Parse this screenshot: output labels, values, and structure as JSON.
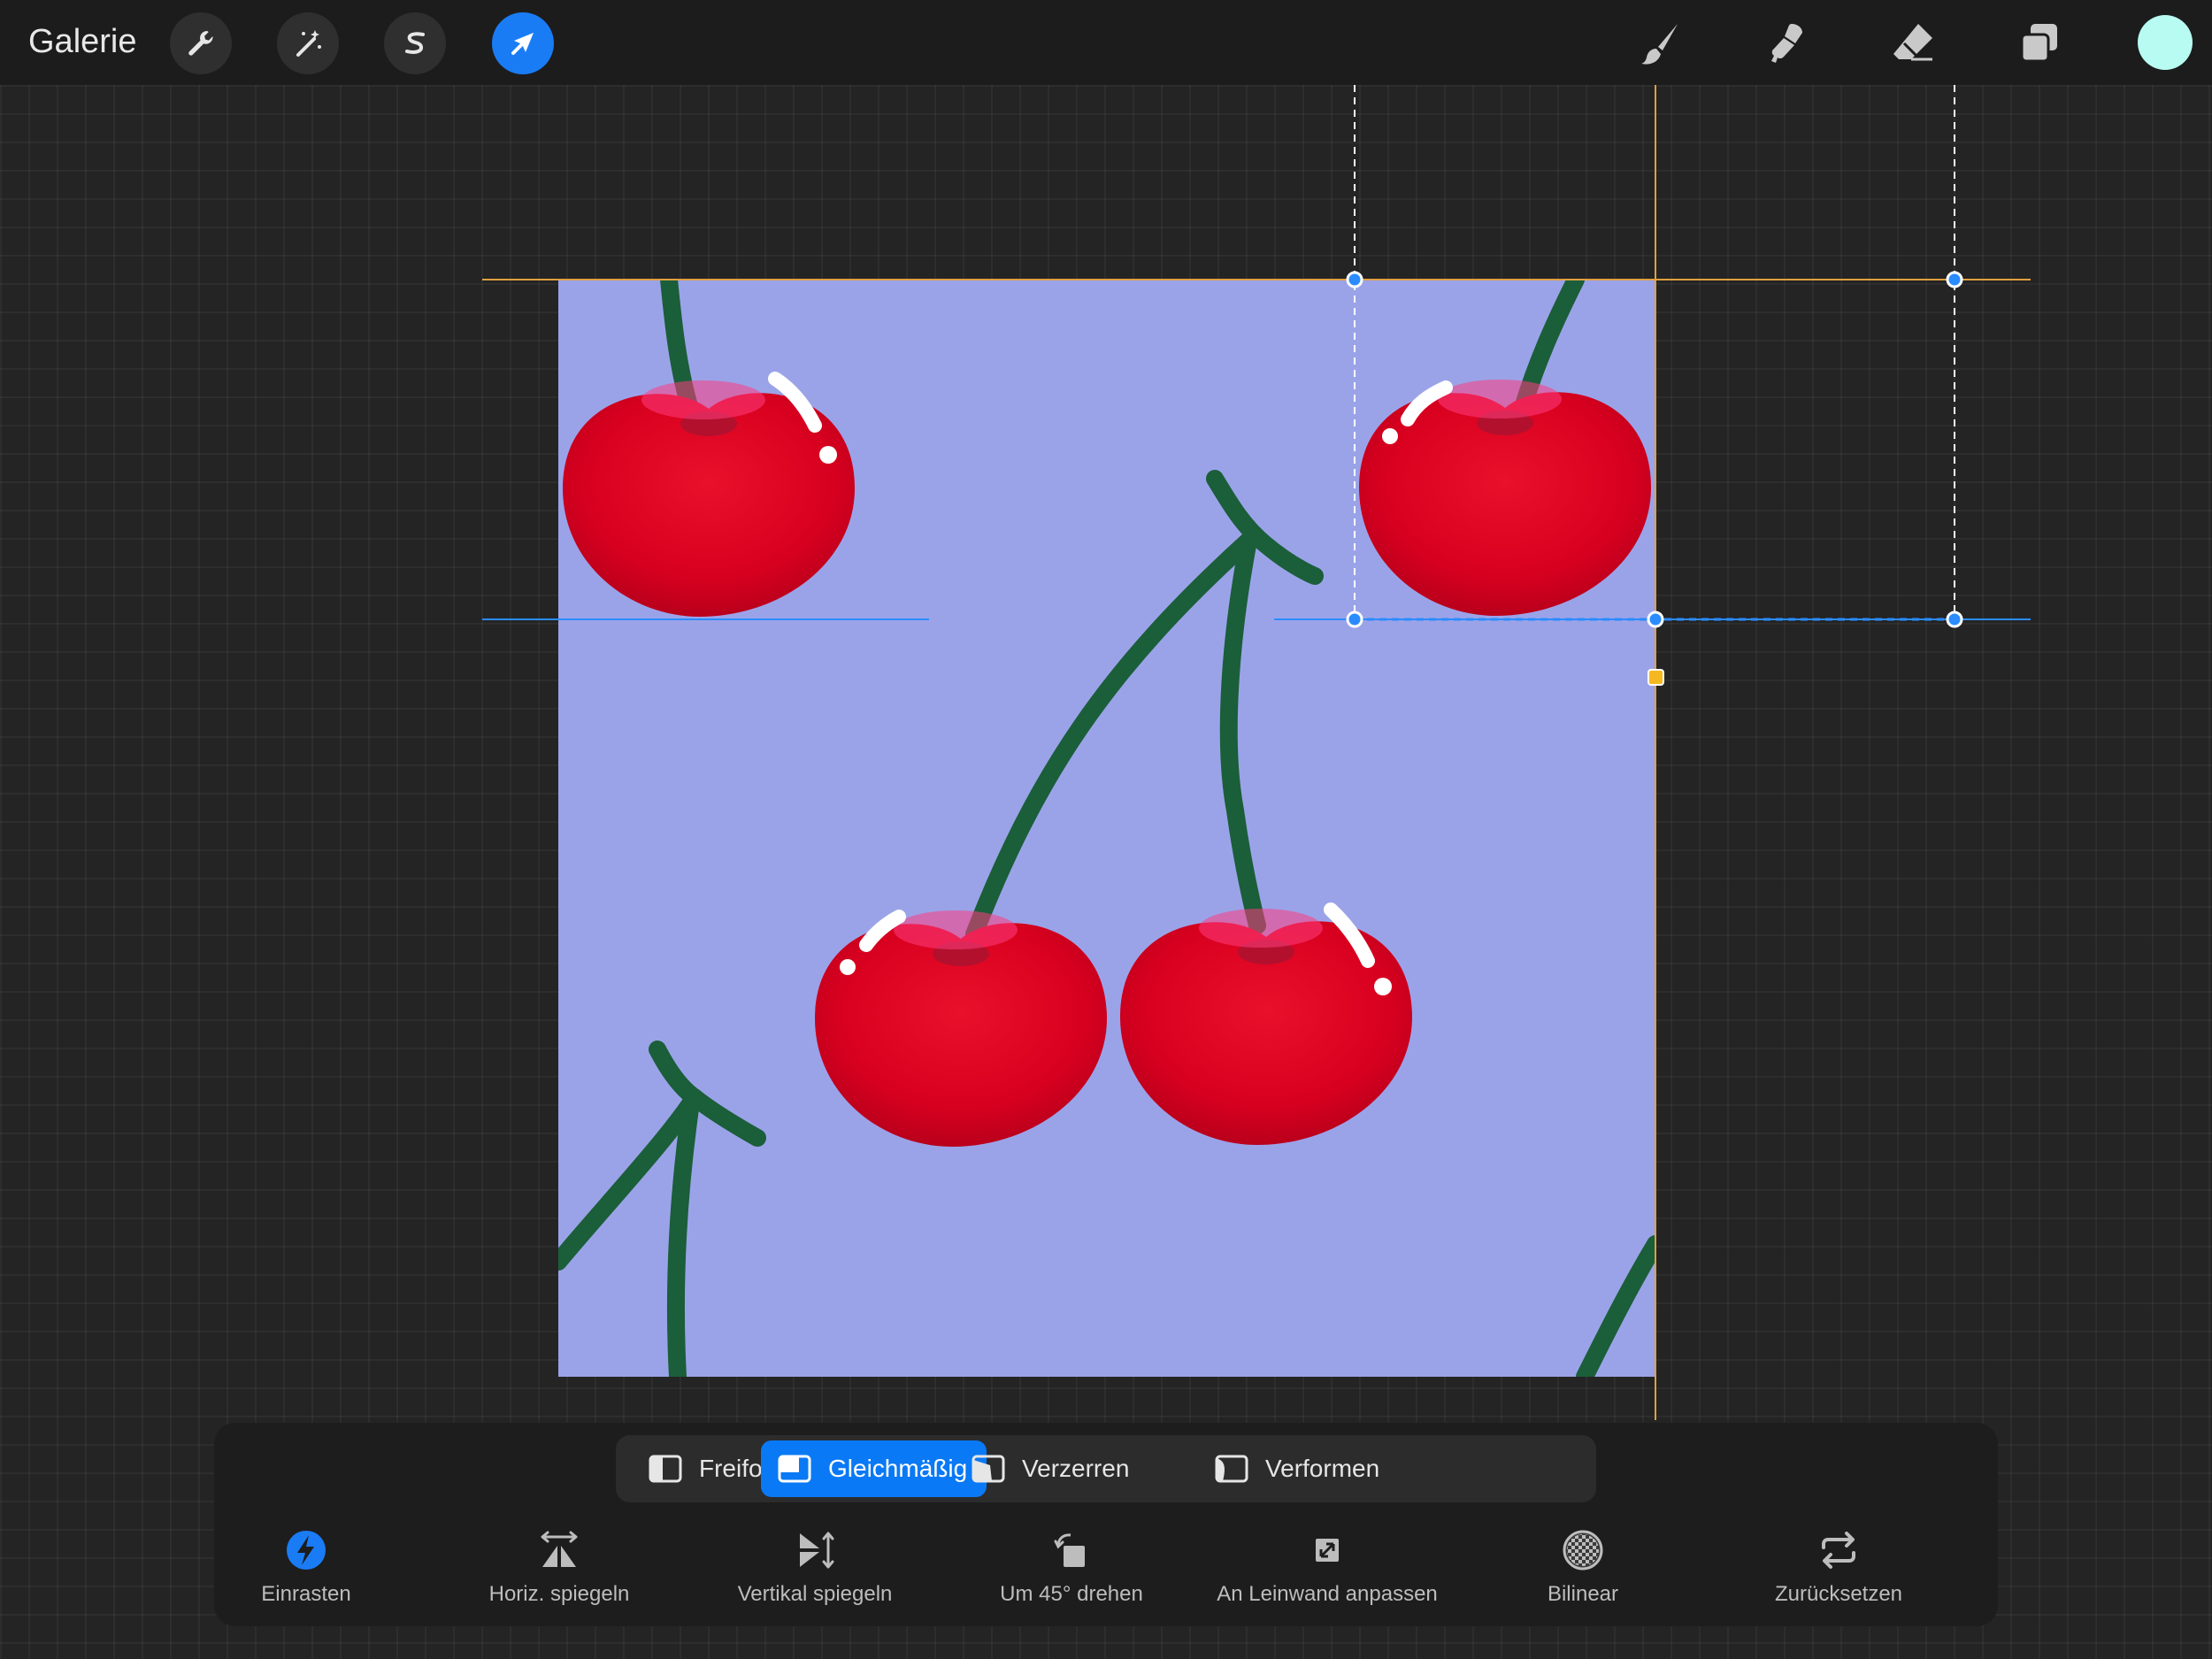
{
  "topbar": {
    "gallery_label": "Galerie",
    "tools_left": [
      "wrench-icon",
      "magic-wand-icon",
      "selection-s-icon",
      "transform-arrow-icon"
    ],
    "tools_right": [
      "brush-icon",
      "smudge-icon",
      "eraser-icon",
      "layers-icon"
    ],
    "active_tool": "transform-arrow-icon",
    "current_color": "#b8fbf2"
  },
  "canvas": {
    "background_color": "#9ba3e8",
    "content": "cherry-pattern-artwork"
  },
  "transform_modes": [
    {
      "label": "Freiform",
      "icon": "freeform-mode-icon",
      "active": false
    },
    {
      "label": "Gleichmäßig",
      "icon": "uniform-mode-icon",
      "active": true
    },
    {
      "label": "Verzerren",
      "icon": "distort-mode-icon",
      "active": false
    },
    {
      "label": "Verformen",
      "icon": "warp-mode-icon",
      "active": false
    }
  ],
  "actions": [
    {
      "label": "Einrasten",
      "icon": "snap-icon",
      "active": true
    },
    {
      "label": "Horiz. spiegeln",
      "icon": "flip-horizontal-icon"
    },
    {
      "label": "Vertikal spiegeln",
      "icon": "flip-vertical-icon"
    },
    {
      "label": "Um 45° drehen",
      "icon": "rotate-45-icon"
    },
    {
      "label": "An Leinwand anpassen",
      "icon": "fit-to-canvas-icon"
    },
    {
      "label": "Bilinear",
      "icon": "bilinear-icon"
    },
    {
      "label": "Zurücksetzen",
      "icon": "reset-icon"
    }
  ],
  "colors": {
    "accent": "#0a79f5",
    "guide_orange": "#e0a040",
    "guide_blue": "#2a8cff",
    "stem": "#1b5e3a",
    "cherry": "#d8001f"
  }
}
